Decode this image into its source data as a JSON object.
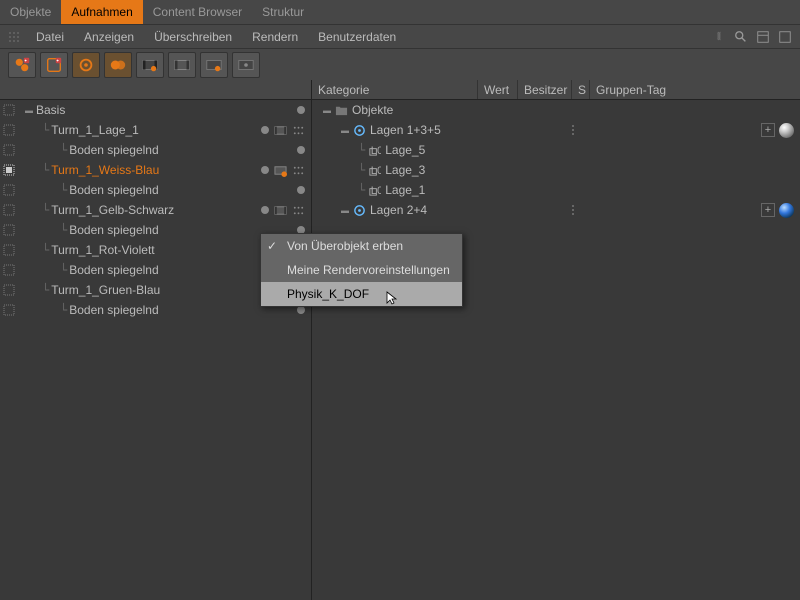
{
  "tabs": [
    "Objekte",
    "Aufnahmen",
    "Content Browser",
    "Struktur"
  ],
  "active_tab": 1,
  "menu": [
    "Datei",
    "Anzeigen",
    "Überschreiben",
    "Rendern",
    "Benutzerdaten"
  ],
  "left_tree": [
    {
      "label": "Basis",
      "level": 0,
      "sel": false,
      "selicon": "empty",
      "expand": "-",
      "status": [
        "dot"
      ]
    },
    {
      "label": "Turm_1_Lage_1",
      "level": 1,
      "sel": false,
      "selicon": "empty",
      "childline": true,
      "status": [
        "dot",
        "film",
        "dots"
      ]
    },
    {
      "label": "Boden spiegelnd",
      "level": 2,
      "sel": false,
      "selicon": "empty",
      "childline": true,
      "status": [
        "dot"
      ]
    },
    {
      "label": "Turm_1_Weiss-Blau",
      "level": 1,
      "sel": true,
      "selicon": "full",
      "childline": true,
      "status": [
        "dot",
        "filmo",
        "dots"
      ]
    },
    {
      "label": "Boden spiegelnd",
      "level": 2,
      "sel": false,
      "selicon": "empty",
      "childline": true,
      "status": [
        "dot"
      ]
    },
    {
      "label": "Turm_1_Gelb-Schwarz",
      "level": 1,
      "sel": false,
      "selicon": "empty",
      "childline": true,
      "status": [
        "dot",
        "film",
        "dots"
      ]
    },
    {
      "label": "Boden spiegelnd",
      "level": 2,
      "sel": false,
      "selicon": "empty",
      "childline": true,
      "status": [
        "dot"
      ]
    },
    {
      "label": "Turm_1_Rot-Violett",
      "level": 1,
      "sel": false,
      "selicon": "empty",
      "childline": true,
      "status": [
        "dot",
        "filmo",
        "dots"
      ]
    },
    {
      "label": "Boden spiegelnd",
      "level": 2,
      "sel": false,
      "selicon": "empty",
      "childline": true,
      "status": [
        "dot"
      ]
    },
    {
      "label": "Turm_1_Gruen-Blau",
      "level": 1,
      "sel": false,
      "selicon": "empty",
      "childline": true,
      "status": [
        "dot",
        "film",
        "dots"
      ]
    },
    {
      "label": "Boden spiegelnd",
      "level": 2,
      "sel": false,
      "selicon": "empty",
      "childline": true,
      "status": [
        "dot"
      ]
    }
  ],
  "right_header": {
    "c1": "Kategorie",
    "c2": "Wert",
    "c3": "Besitzer",
    "c4": "S",
    "c5": "Gruppen-Tag"
  },
  "right_tree": [
    {
      "label": "Objekte",
      "icon": "folder",
      "level": 0,
      "expand": "-"
    },
    {
      "label": "Lagen 1+3+5",
      "icon": "render",
      "level": 1,
      "expand": "-",
      "tags": [
        "plus",
        "sphere-grey"
      ],
      "dotcol": true
    },
    {
      "label": "Lage_5",
      "icon": "layer",
      "level": 2,
      "childline": true
    },
    {
      "label": "Lage_3",
      "icon": "layer",
      "level": 2,
      "childline": true
    },
    {
      "label": "Lage_1",
      "icon": "layer",
      "level": 2,
      "childline": true
    },
    {
      "label": "Lagen 2+4",
      "icon": "render",
      "level": 1,
      "expand": "-",
      "tags": [
        "plus",
        "sphere-blue"
      ],
      "dotcol": true
    }
  ],
  "context_menu": [
    {
      "label": "Von Überobjekt erben",
      "checked": true
    },
    {
      "label": "Meine Rendervoreinstellungen"
    },
    {
      "label": "Physik_K_DOF",
      "highlight": true
    }
  ]
}
